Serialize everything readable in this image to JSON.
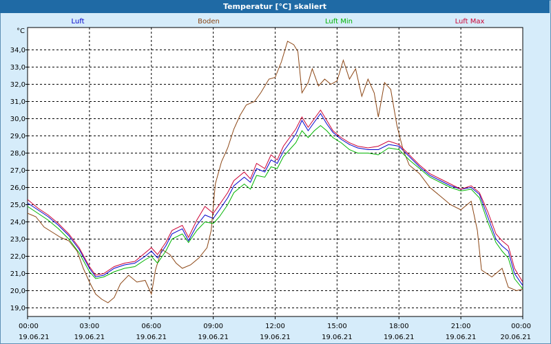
{
  "window_title": "Temperatur [°C] skaliert",
  "chart_data": {
    "type": "line",
    "title": "Temperatur [°C] skaliert",
    "ylabel": "°C",
    "ylim": [
      18.5,
      35.3
    ],
    "yticks": [
      19.0,
      20.0,
      21.0,
      22.0,
      23.0,
      24.0,
      25.0,
      26.0,
      27.0,
      28.0,
      29.0,
      30.0,
      31.0,
      32.0,
      33.0,
      34.0
    ],
    "ytick_labels": [
      "19,0",
      "20,0",
      "21,0",
      "22,0",
      "23,0",
      "24,0",
      "25,0",
      "26,0",
      "27,0",
      "28,0",
      "29,0",
      "30,0",
      "31,0",
      "32,0",
      "33,0",
      "34,0"
    ],
    "xlim": [
      0,
      24
    ],
    "xticks": [
      0,
      3,
      6,
      9,
      12,
      15,
      18,
      21,
      24
    ],
    "xtick_labels": [
      {
        "time": "00:00",
        "date": "19.06.21"
      },
      {
        "time": "03:00",
        "date": "19.06.21"
      },
      {
        "time": "06:00",
        "date": "19.06.21"
      },
      {
        "time": "09:00",
        "date": "19.06.21"
      },
      {
        "time": "12:00",
        "date": "19.06.21"
      },
      {
        "time": "15:00",
        "date": "19.06.21"
      },
      {
        "time": "18:00",
        "date": "19.06.21"
      },
      {
        "time": "21:00",
        "date": "19.06.21"
      },
      {
        "time": "00:00",
        "date": "20.06.21"
      }
    ],
    "grid": true,
    "legend_position": "top",
    "series": [
      {
        "name": "Luft",
        "color": "#0000cc",
        "points": [
          [
            0,
            25.1
          ],
          [
            0.5,
            24.7
          ],
          [
            1,
            24.3
          ],
          [
            1.5,
            23.8
          ],
          [
            2,
            23.2
          ],
          [
            2.5,
            22.4
          ],
          [
            3,
            21.3
          ],
          [
            3.3,
            20.8
          ],
          [
            3.7,
            20.9
          ],
          [
            4.2,
            21.3
          ],
          [
            4.7,
            21.5
          ],
          [
            5.2,
            21.6
          ],
          [
            5.7,
            22.0
          ],
          [
            6,
            22.3
          ],
          [
            6.3,
            21.9
          ],
          [
            6.7,
            22.6
          ],
          [
            7,
            23.3
          ],
          [
            7.5,
            23.6
          ],
          [
            7.8,
            22.9
          ],
          [
            8.2,
            23.8
          ],
          [
            8.6,
            24.4
          ],
          [
            9,
            24.2
          ],
          [
            9.3,
            24.7
          ],
          [
            9.7,
            25.4
          ],
          [
            10,
            26.1
          ],
          [
            10.5,
            26.6
          ],
          [
            10.8,
            26.3
          ],
          [
            11.1,
            27.1
          ],
          [
            11.5,
            26.9
          ],
          [
            11.8,
            27.6
          ],
          [
            12.1,
            27.4
          ],
          [
            12.4,
            28.1
          ],
          [
            12.7,
            28.6
          ],
          [
            13,
            29.1
          ],
          [
            13.3,
            29.9
          ],
          [
            13.6,
            29.3
          ],
          [
            13.9,
            29.8
          ],
          [
            14.2,
            30.3
          ],
          [
            14.5,
            29.7
          ],
          [
            14.8,
            29.2
          ],
          [
            15.2,
            28.8
          ],
          [
            15.6,
            28.5
          ],
          [
            16,
            28.3
          ],
          [
            16.5,
            28.2
          ],
          [
            17,
            28.2
          ],
          [
            17.5,
            28.5
          ],
          [
            18,
            28.4
          ],
          [
            18.5,
            27.8
          ],
          [
            19,
            27.2
          ],
          [
            19.5,
            26.7
          ],
          [
            20,
            26.4
          ],
          [
            20.5,
            26.1
          ],
          [
            21,
            25.9
          ],
          [
            21.5,
            26.0
          ],
          [
            21.9,
            25.6
          ],
          [
            22.3,
            24.3
          ],
          [
            22.7,
            23.0
          ],
          [
            23,
            22.6
          ],
          [
            23.3,
            22.3
          ],
          [
            23.6,
            21.0
          ],
          [
            24,
            20.3
          ]
        ]
      },
      {
        "name": "Boden",
        "color": "#8b4513",
        "points": [
          [
            0,
            24.5
          ],
          [
            0.4,
            24.3
          ],
          [
            0.8,
            23.7
          ],
          [
            1.2,
            23.4
          ],
          [
            1.6,
            23.1
          ],
          [
            2,
            22.9
          ],
          [
            2.4,
            22.3
          ],
          [
            2.7,
            21.3
          ],
          [
            3,
            20.5
          ],
          [
            3.3,
            19.8
          ],
          [
            3.6,
            19.5
          ],
          [
            3.9,
            19.3
          ],
          [
            4.2,
            19.6
          ],
          [
            4.5,
            20.4
          ],
          [
            4.9,
            20.9
          ],
          [
            5.3,
            20.5
          ],
          [
            5.7,
            20.6
          ],
          [
            6,
            19.8
          ],
          [
            6.2,
            21.2
          ],
          [
            6.5,
            22.4
          ],
          [
            6.9,
            22.1
          ],
          [
            7.2,
            21.6
          ],
          [
            7.5,
            21.3
          ],
          [
            7.9,
            21.5
          ],
          [
            8.3,
            21.9
          ],
          [
            8.7,
            22.5
          ],
          [
            8.9,
            23.5
          ],
          [
            9.1,
            26.2
          ],
          [
            9.4,
            27.5
          ],
          [
            9.7,
            28.3
          ],
          [
            10,
            29.4
          ],
          [
            10.3,
            30.2
          ],
          [
            10.6,
            30.8
          ],
          [
            11,
            31.0
          ],
          [
            11.3,
            31.5
          ],
          [
            11.7,
            32.3
          ],
          [
            12,
            32.4
          ],
          [
            12.3,
            33.3
          ],
          [
            12.6,
            34.5
          ],
          [
            12.9,
            34.3
          ],
          [
            13.1,
            33.9
          ],
          [
            13.3,
            31.5
          ],
          [
            13.6,
            32.1
          ],
          [
            13.8,
            32.9
          ],
          [
            14.1,
            31.9
          ],
          [
            14.4,
            32.3
          ],
          [
            14.7,
            32.0
          ],
          [
            15,
            32.2
          ],
          [
            15.3,
            33.4
          ],
          [
            15.6,
            32.3
          ],
          [
            15.9,
            32.9
          ],
          [
            16.2,
            31.3
          ],
          [
            16.5,
            32.3
          ],
          [
            16.8,
            31.5
          ],
          [
            17,
            30.1
          ],
          [
            17.3,
            32.1
          ],
          [
            17.6,
            31.7
          ],
          [
            17.9,
            29.6
          ],
          [
            18.2,
            28.2
          ],
          [
            18.5,
            27.3
          ],
          [
            19,
            26.8
          ],
          [
            19.5,
            26.0
          ],
          [
            20,
            25.5
          ],
          [
            20.5,
            25.0
          ],
          [
            21,
            24.7
          ],
          [
            21.5,
            25.2
          ],
          [
            21.8,
            23.5
          ],
          [
            22,
            21.2
          ],
          [
            22.5,
            20.8
          ],
          [
            23,
            21.3
          ],
          [
            23.3,
            20.2
          ],
          [
            23.7,
            20.0
          ],
          [
            24,
            20.1
          ]
        ]
      },
      {
        "name": "Luft Min",
        "color": "#00b400",
        "points": [
          [
            0,
            24.9
          ],
          [
            0.5,
            24.5
          ],
          [
            1,
            24.1
          ],
          [
            1.5,
            23.6
          ],
          [
            2,
            23.0
          ],
          [
            2.5,
            22.2
          ],
          [
            3,
            21.1
          ],
          [
            3.3,
            20.7
          ],
          [
            3.7,
            20.8
          ],
          [
            4.2,
            21.1
          ],
          [
            4.7,
            21.3
          ],
          [
            5.2,
            21.4
          ],
          [
            5.7,
            21.8
          ],
          [
            6,
            22.0
          ],
          [
            6.3,
            21.6
          ],
          [
            6.7,
            22.3
          ],
          [
            7,
            23.0
          ],
          [
            7.5,
            23.3
          ],
          [
            7.8,
            22.8
          ],
          [
            8.2,
            23.5
          ],
          [
            8.6,
            24.0
          ],
          [
            9,
            23.9
          ],
          [
            9.3,
            24.3
          ],
          [
            9.7,
            25.0
          ],
          [
            10,
            25.7
          ],
          [
            10.5,
            26.2
          ],
          [
            10.8,
            25.9
          ],
          [
            11.1,
            26.7
          ],
          [
            11.5,
            26.6
          ],
          [
            11.8,
            27.2
          ],
          [
            12.1,
            27.1
          ],
          [
            12.4,
            27.8
          ],
          [
            12.7,
            28.2
          ],
          [
            13,
            28.6
          ],
          [
            13.3,
            29.3
          ],
          [
            13.6,
            28.9
          ],
          [
            13.9,
            29.3
          ],
          [
            14.2,
            29.6
          ],
          [
            14.5,
            29.3
          ],
          [
            14.8,
            28.9
          ],
          [
            15.2,
            28.6
          ],
          [
            15.6,
            28.2
          ],
          [
            16,
            28.0
          ],
          [
            16.5,
            28.0
          ],
          [
            17,
            27.9
          ],
          [
            17.5,
            28.3
          ],
          [
            18,
            28.2
          ],
          [
            18.5,
            27.6
          ],
          [
            19,
            27.1
          ],
          [
            19.5,
            26.6
          ],
          [
            20,
            26.3
          ],
          [
            20.5,
            26.0
          ],
          [
            21,
            25.8
          ],
          [
            21.5,
            25.9
          ],
          [
            21.9,
            25.4
          ],
          [
            22.3,
            24.0
          ],
          [
            22.7,
            22.8
          ],
          [
            23,
            22.3
          ],
          [
            23.3,
            21.9
          ],
          [
            23.6,
            20.7
          ],
          [
            24,
            20.1
          ]
        ]
      },
      {
        "name": "Luft Max",
        "color": "#cc0033",
        "points": [
          [
            0,
            25.3
          ],
          [
            0.5,
            24.8
          ],
          [
            1,
            24.4
          ],
          [
            1.5,
            23.9
          ],
          [
            2,
            23.3
          ],
          [
            2.5,
            22.5
          ],
          [
            3,
            21.4
          ],
          [
            3.3,
            20.9
          ],
          [
            3.7,
            21.0
          ],
          [
            4.2,
            21.4
          ],
          [
            4.7,
            21.6
          ],
          [
            5.2,
            21.7
          ],
          [
            5.7,
            22.2
          ],
          [
            6,
            22.5
          ],
          [
            6.3,
            22.1
          ],
          [
            6.7,
            22.8
          ],
          [
            7,
            23.5
          ],
          [
            7.5,
            23.8
          ],
          [
            7.8,
            23.1
          ],
          [
            8.2,
            24.1
          ],
          [
            8.6,
            24.9
          ],
          [
            9,
            24.5
          ],
          [
            9.3,
            25.0
          ],
          [
            9.7,
            25.7
          ],
          [
            10,
            26.4
          ],
          [
            10.5,
            26.9
          ],
          [
            10.8,
            26.5
          ],
          [
            11.1,
            27.4
          ],
          [
            11.5,
            27.1
          ],
          [
            11.8,
            27.9
          ],
          [
            12.1,
            27.6
          ],
          [
            12.4,
            28.4
          ],
          [
            12.7,
            28.9
          ],
          [
            13,
            29.4
          ],
          [
            13.3,
            30.1
          ],
          [
            13.6,
            29.5
          ],
          [
            13.9,
            30.0
          ],
          [
            14.2,
            30.5
          ],
          [
            14.5,
            29.9
          ],
          [
            14.8,
            29.3
          ],
          [
            15.2,
            28.9
          ],
          [
            15.6,
            28.6
          ],
          [
            16,
            28.4
          ],
          [
            16.5,
            28.3
          ],
          [
            17,
            28.4
          ],
          [
            17.5,
            28.7
          ],
          [
            18,
            28.5
          ],
          [
            18.5,
            27.9
          ],
          [
            19,
            27.3
          ],
          [
            19.5,
            26.8
          ],
          [
            20,
            26.5
          ],
          [
            20.5,
            26.2
          ],
          [
            21,
            25.9
          ],
          [
            21.5,
            26.1
          ],
          [
            21.9,
            25.7
          ],
          [
            22.3,
            24.6
          ],
          [
            22.7,
            23.3
          ],
          [
            23,
            22.9
          ],
          [
            23.3,
            22.6
          ],
          [
            23.6,
            21.3
          ],
          [
            24,
            20.5
          ]
        ]
      }
    ]
  }
}
